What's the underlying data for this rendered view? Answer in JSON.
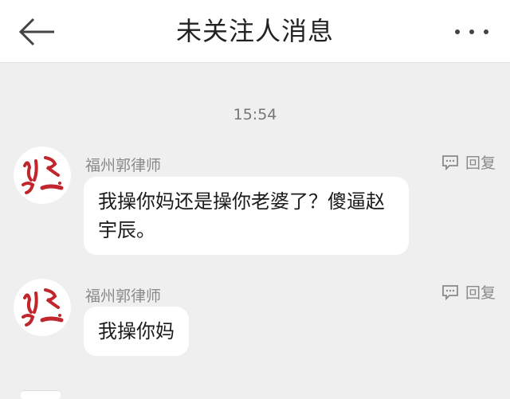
{
  "header": {
    "title": "未关注人消息",
    "back_icon": "arrow-left-icon",
    "more_icon": "more-dots-icon"
  },
  "timestamp": "15:54",
  "messages": [
    {
      "sender": "福州郭律师",
      "text": "我操你妈还是操你老婆了？傻逼赵宇辰。",
      "reply_label": "回复",
      "reply_icon": "comment-icon"
    },
    {
      "sender": "福州郭律师",
      "text": "我操你妈",
      "reply_label": "回复",
      "reply_icon": "comment-icon"
    }
  ],
  "colors": {
    "background": "#efefef",
    "bubble": "#ffffff",
    "avatar_ink": "#c0262b"
  }
}
